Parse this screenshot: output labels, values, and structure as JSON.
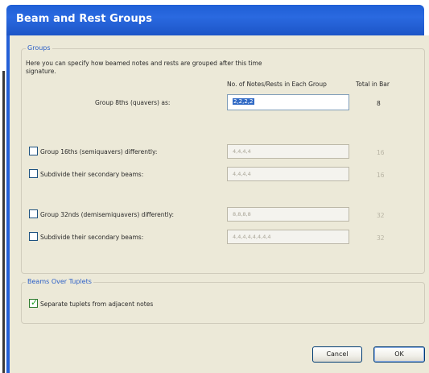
{
  "window": {
    "title": "Beam and Rest Groups"
  },
  "groups": {
    "label": "Groups",
    "description_line1": "Here you can specify how beamed notes and rests are grouped after this time",
    "description_line2": "signature.",
    "col_notes_header": "No. of Notes/Rests in Each Group",
    "col_total_header": "Total in Bar",
    "eighths": {
      "label": "Group 8ths (quavers) as:",
      "value": "2,2,2,2",
      "total": "8"
    },
    "sixteenths": {
      "label": "Group 16ths (semiquavers) differently:",
      "checked": false,
      "value": "4,4,4,4",
      "total": "16"
    },
    "sixteenths_sub": {
      "label": "Subdivide their secondary beams:",
      "checked": false,
      "value": "4,4,4,4",
      "total": "16"
    },
    "thirtyseconds": {
      "label": "Group 32nds (demisemiquavers) differently:",
      "checked": false,
      "value": "8,8,8,8",
      "total": "32"
    },
    "thirtyseconds_sub": {
      "label": "Subdivide their secondary beams:",
      "checked": false,
      "value": "4,4,4,4,4,4,4,4",
      "total": "32"
    }
  },
  "tuplets": {
    "label": "Beams Over Tuplets",
    "separate_label": "Separate tuplets from adjacent notes",
    "separate_checked": true
  },
  "buttons": {
    "cancel": "Cancel",
    "ok": "OK"
  },
  "colors": {
    "titlebar": "#2a69e0",
    "dialog_bg": "#ece9d8",
    "group_label": "#2b5fc7",
    "selection": "#316ac5"
  }
}
